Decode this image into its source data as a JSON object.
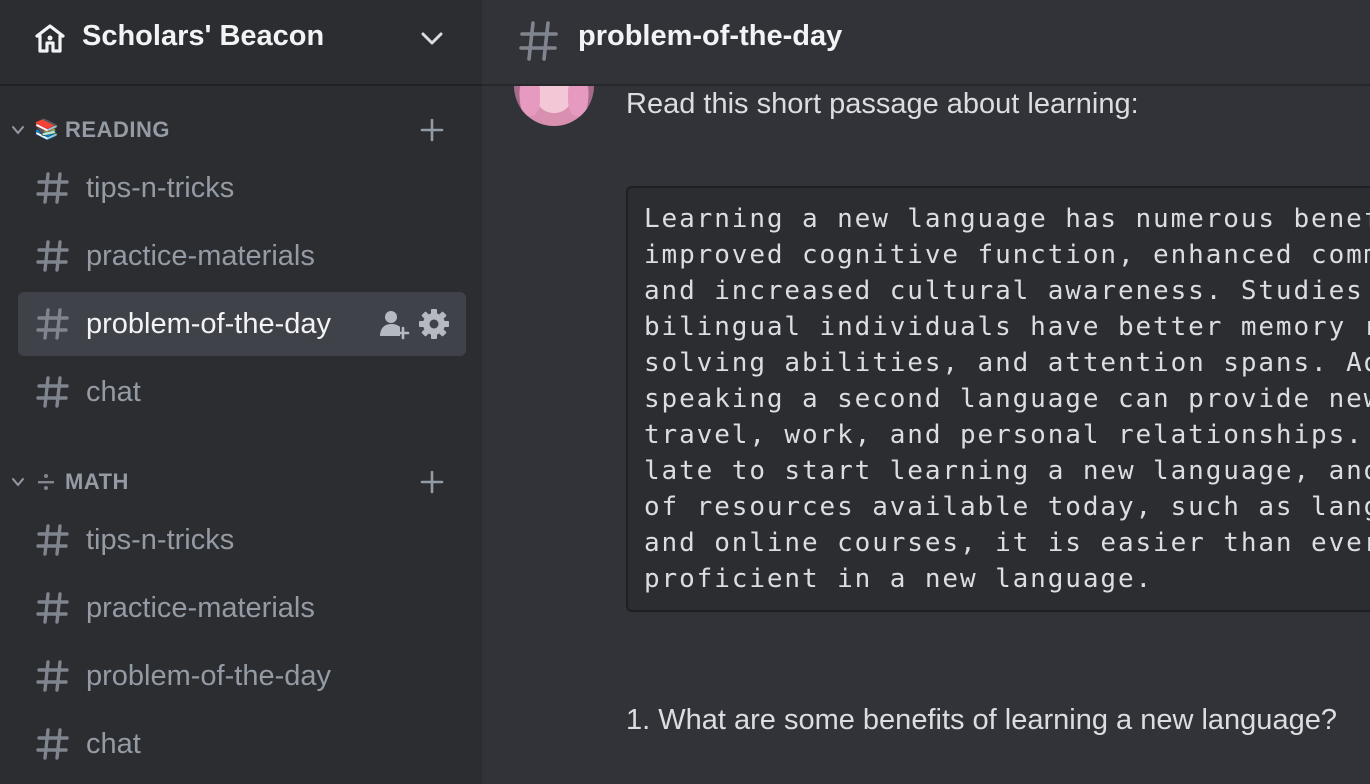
{
  "server": {
    "name": "Scholars' Beacon",
    "icon": "home-icon",
    "menu_icon": "chevron-down-icon"
  },
  "categories": [
    {
      "label": "READING",
      "emoji": "📚",
      "channels": [
        {
          "label": "tips-n-tricks",
          "active": false
        },
        {
          "label": "practice-materials",
          "active": false
        },
        {
          "label": "problem-of-the-day",
          "active": true
        },
        {
          "label": "chat",
          "active": false
        }
      ]
    },
    {
      "label": "MATH",
      "emoji": "➗",
      "channels": [
        {
          "label": "tips-n-tricks",
          "active": false
        },
        {
          "label": "practice-materials",
          "active": false
        },
        {
          "label": "problem-of-the-day",
          "active": false
        },
        {
          "label": "chat",
          "active": false
        }
      ]
    }
  ],
  "channel_header": {
    "title": "problem-of-the-day"
  },
  "message": {
    "text": "Read this short passage about learning:",
    "code_lines": [
      "Learning a new language has numerous benefits, including",
      "improved cognitive function, enhanced communication skills,",
      "and increased cultural awareness. Studies have shown that",
      "bilingual individuals have better memory retention, problem-",
      "solving abilities, and attention spans. Additionally,",
      "speaking a second language can provide new opportunities for",
      "travel, work, and personal relationships. It's never too",
      "late to start learning a new language, and with the plethora",
      "of resources available today, such as language learning apps",
      "and online courses, it is easier than ever before to become",
      "proficient in a new language."
    ],
    "question": "1. What are some benefits of learning a new language?"
  },
  "colors": {
    "sidebar_bg": "#2b2d31",
    "main_bg": "#313338",
    "active_channel_bg": "#404249",
    "muted_text": "#949ba4",
    "bright_text": "#f2f3f5"
  }
}
